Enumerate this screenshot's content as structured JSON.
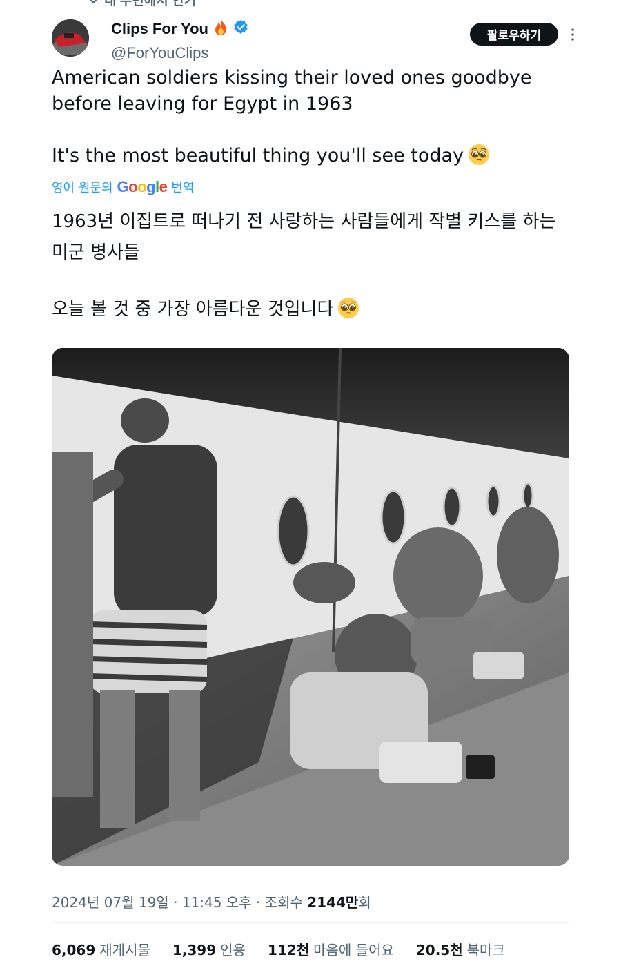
{
  "social_context": "내 주변에서 인기",
  "author": {
    "name": "Clips For You",
    "handle": "@ForYouClips",
    "verified": true
  },
  "follow_button": "팔로우하기",
  "tweet": {
    "text_line1": "American soldiers kissing their loved ones goodbye before leaving for Egypt in 1963",
    "text_line2": "It's the most beautiful thing you'll see today"
  },
  "translation": {
    "prefix": "영어 원문의",
    "provider": "Google",
    "suffix": "번역",
    "text_line1": "1963년 이집트로 떠나기 전 사랑하는 사람들에게 작별 키스를 하는 미군 병사들",
    "text_line2": "오늘 볼 것 중 가장 아름다운 것입니다"
  },
  "meta": {
    "date": "2024년 07월 19일",
    "time": "11:45 오후",
    "views_label": "조회수",
    "views_value": "2144만",
    "views_suffix": "회"
  },
  "stats": [
    {
      "value": "6,069",
      "label": "재게시물"
    },
    {
      "value": "1,399",
      "label": "인용"
    },
    {
      "value": "112천",
      "label": "마음에 들어요"
    },
    {
      "value": "20.5천",
      "label": "북마크"
    }
  ],
  "colors": {
    "accent": "#1d9bf0",
    "text": "#0f1419",
    "secondary": "#536471",
    "button_bg": "#0f1419"
  }
}
